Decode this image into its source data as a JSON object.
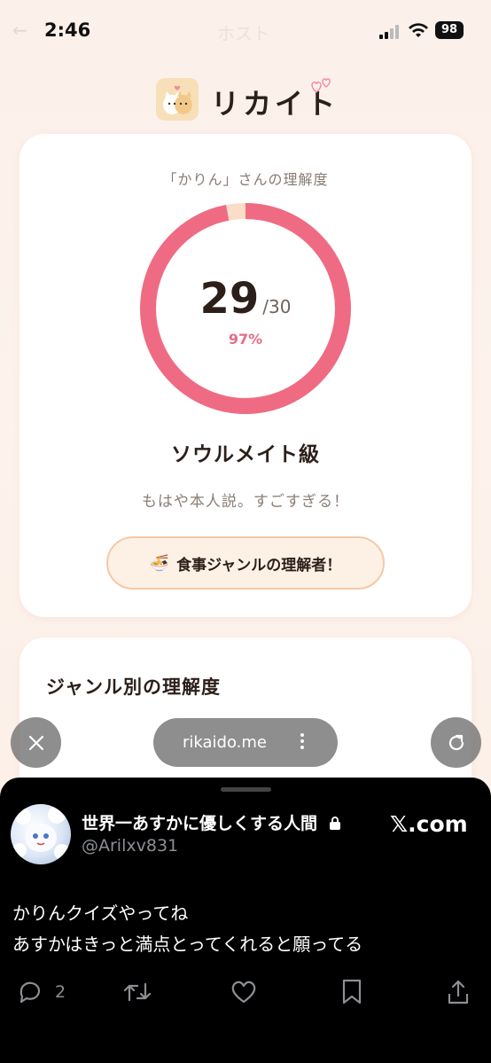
{
  "status_bar": {
    "time": "2:46",
    "battery": "98",
    "back_label": "←",
    "page_title": "ホスト"
  },
  "brand": {
    "name": "リカイト"
  },
  "score_card": {
    "subtitle": "「かりん」さんの理解度",
    "score": "29",
    "total": "/30",
    "percent_text": "97%",
    "percent_value": 0.97,
    "rank": "ソウルメイト級",
    "comment": "もはや本人説。すごすぎる！",
    "badge_icon": "🍜",
    "badge_label": "食事ジャンルの理解者！"
  },
  "genre_card": {
    "title": "ジャンル別の理解度"
  },
  "browser": {
    "url": "rikaido.me"
  },
  "tweet": {
    "author_name": "世界一あすかに優しくする人間",
    "handle": "@Arilxv831",
    "site": "𝕏.com",
    "text_line1": "かりんクイズやってね",
    "text_line2": "あすかはきっと満点とってくれると願ってる",
    "reply_count": "2"
  },
  "colors": {
    "ring": "#ef6b83",
    "ring_track": "#fbdcc8",
    "accent_pink": "#e46d88",
    "badge_border": "#f4c9a8"
  },
  "icons": {
    "close": "close-icon",
    "reload": "reload-icon",
    "more": "more-vertical-icon",
    "reply": "reply-icon",
    "retweet": "retweet-icon",
    "like": "heart-icon",
    "bookmark": "bookmark-icon",
    "share": "share-icon"
  }
}
